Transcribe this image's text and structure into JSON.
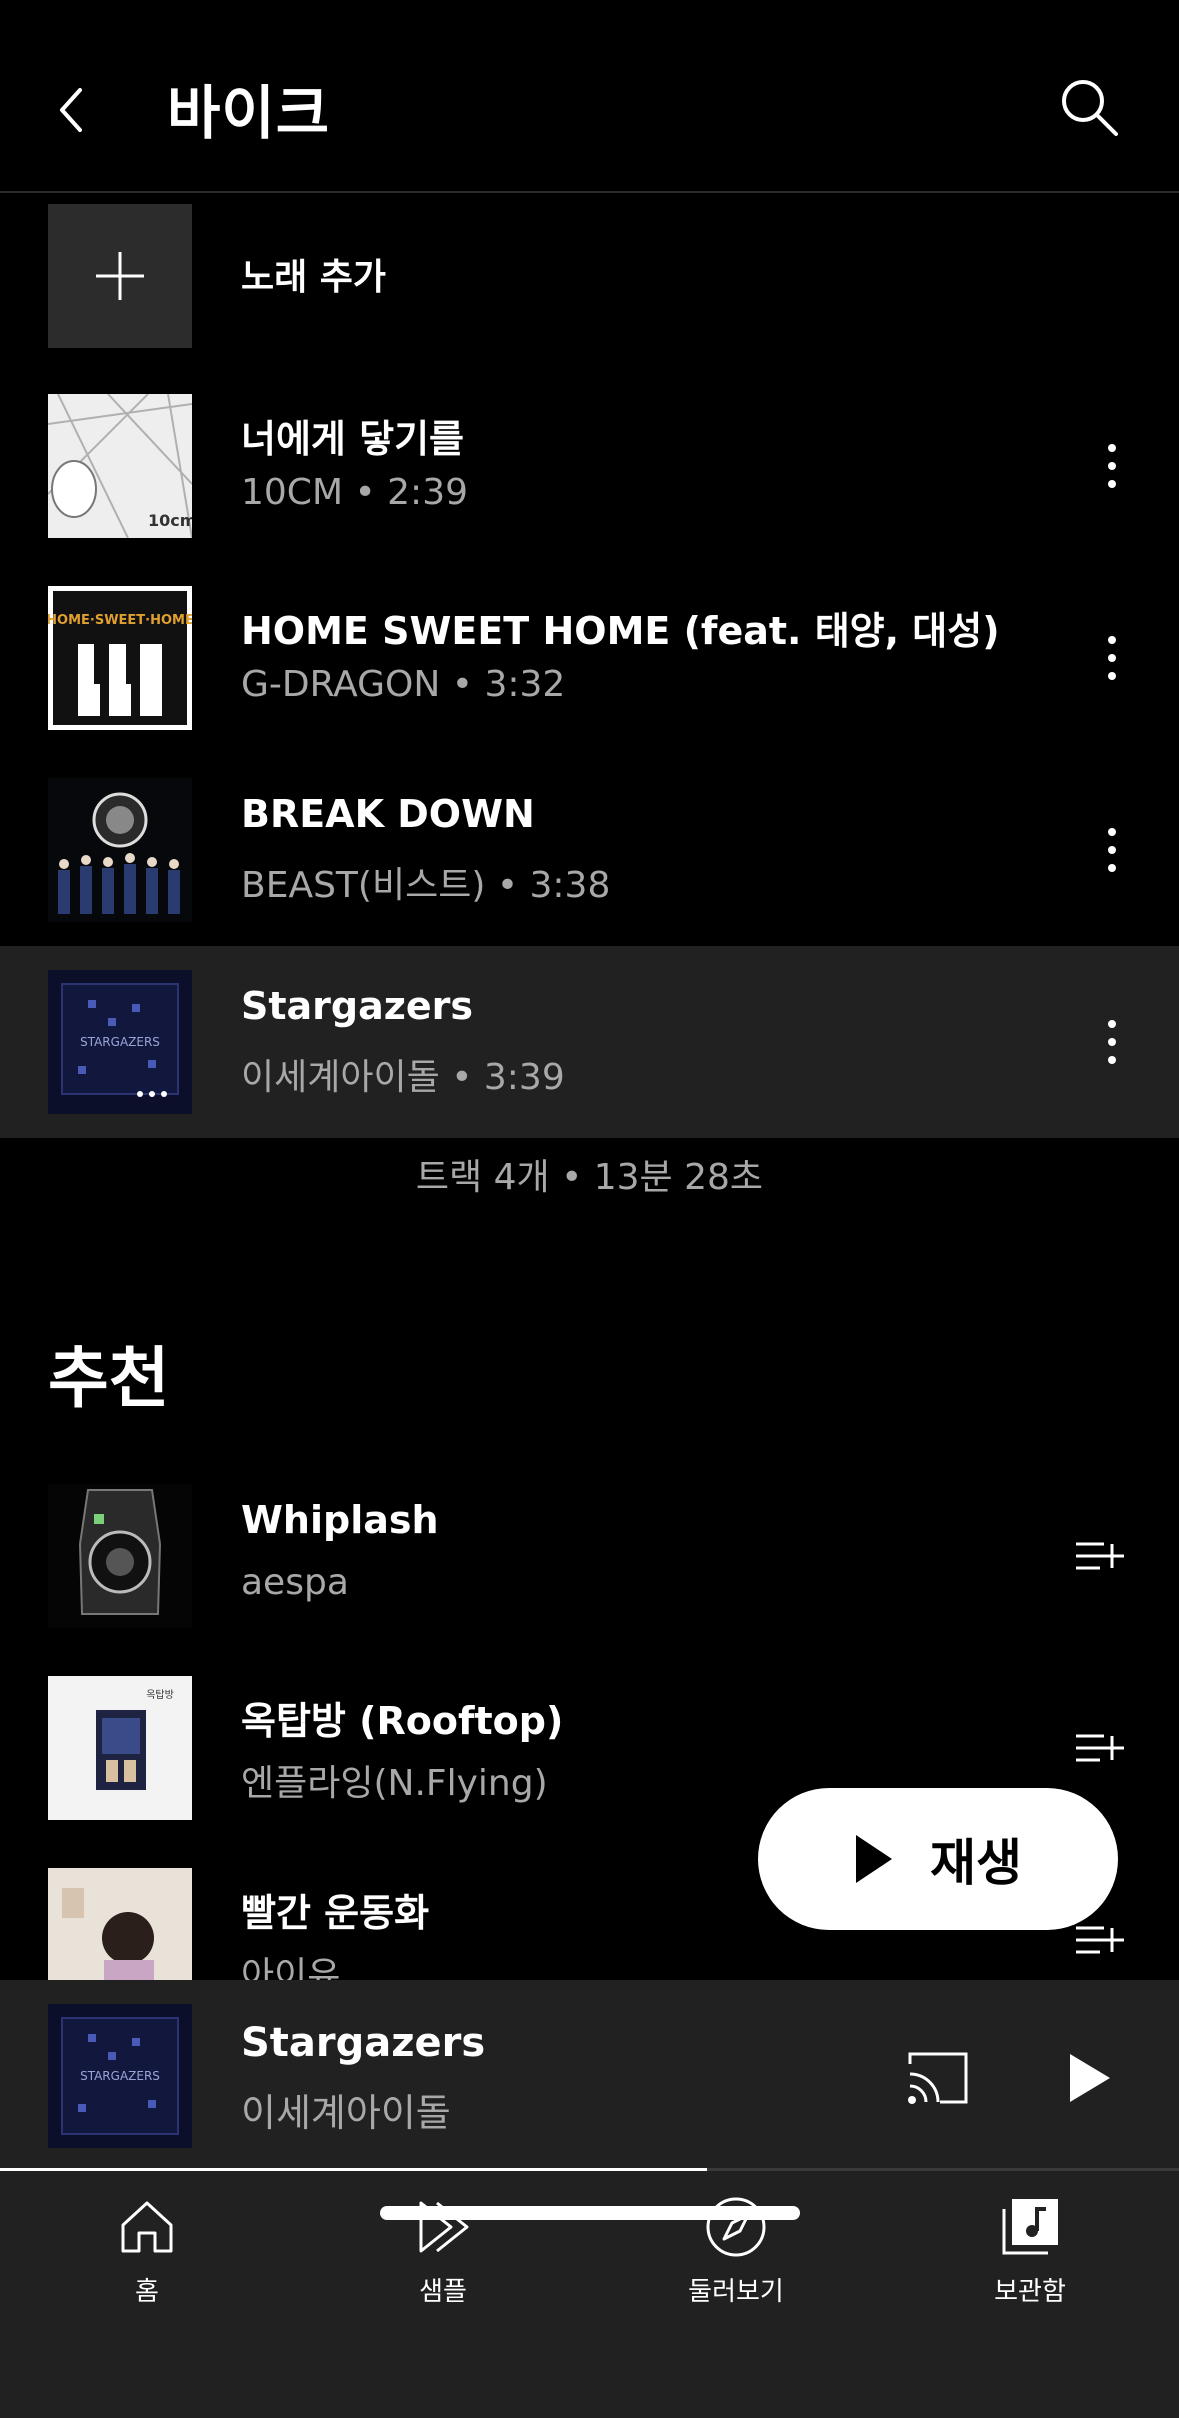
{
  "header": {
    "title": "바이크"
  },
  "add_song": {
    "label": "노래 추가"
  },
  "tracks": [
    {
      "title": "너에게 닿기를",
      "artist": "10CM",
      "duration": "2:39"
    },
    {
      "title": "HOME SWEET HOME (feat. 태양, 대성)",
      "artist": "G-DRAGON",
      "duration": "3:32"
    },
    {
      "title": "BREAK DOWN",
      "artist": "BEAST(비스트)",
      "duration": "3:38"
    },
    {
      "title": "Stargazers",
      "artist": "이세계아이돌",
      "duration": "3:39"
    }
  ],
  "separator": "•",
  "summary": "트랙 4개 • 13분 28초",
  "recommendations": {
    "title": "추천",
    "items": [
      {
        "title": "Whiplash",
        "artist": "aespa"
      },
      {
        "title": "옥탑방 (Rooftop)",
        "artist": "엔플라잉(N.Flying)"
      },
      {
        "title": "빨간 운동화",
        "artist": "아이유"
      }
    ]
  },
  "play_button": {
    "label": "재생"
  },
  "mini_player": {
    "title": "Stargazers",
    "artist": "이세계아이돌",
    "progress": 0.6
  },
  "art_text": {
    "track1": "10cm",
    "track2": "HOME·SWEET·HOME",
    "track4": "STARGAZERS",
    "rec2": "옥탑방"
  },
  "nav": [
    {
      "label": "홈",
      "icon": "home-icon"
    },
    {
      "label": "샘플",
      "icon": "samples-icon"
    },
    {
      "label": "둘러보기",
      "icon": "explore-icon"
    },
    {
      "label": "보관함",
      "icon": "library-icon"
    }
  ],
  "colors": {
    "background": "#000000",
    "surface": "#212121",
    "secondary_text": "#a8a8a8",
    "accent": "#ffffff"
  }
}
